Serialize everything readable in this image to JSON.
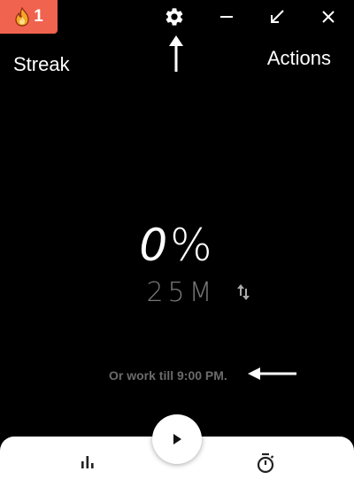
{
  "streak": {
    "count": "1",
    "label": "Streak",
    "badge_color": "#f0634e"
  },
  "toolbar": {
    "icons": [
      "gear-icon",
      "minimize-icon",
      "shrink-icon",
      "close-icon"
    ]
  },
  "actions": {
    "label": "Actions"
  },
  "progress": {
    "percent_digit": "0",
    "percent_sign": "%"
  },
  "session": {
    "duration": "25M",
    "work_till": "Or work till 9:00 PM."
  },
  "bottom_bar": {
    "icons": [
      "stats-icon",
      "play-icon",
      "timer-icon"
    ]
  },
  "colors": {
    "background": "#000000",
    "accent": "#f0634e",
    "muted_text": "#777777",
    "bottom_bar": "#ffffff"
  }
}
